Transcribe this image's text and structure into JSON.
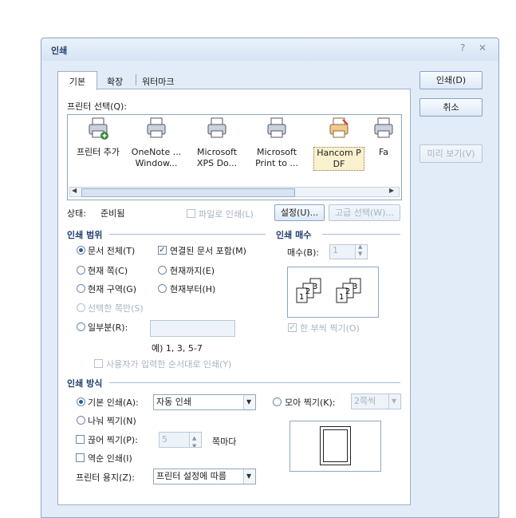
{
  "dialog": {
    "title": "인쇄",
    "help_icon": "?",
    "close_icon": "✕"
  },
  "tabs": [
    {
      "label": "기본"
    },
    {
      "label": "확장"
    },
    {
      "label": "워터마크"
    }
  ],
  "buttons": {
    "print": "인쇄(D)",
    "cancel": "취소",
    "preview": "미리 보기(V)"
  },
  "printer_select": {
    "label": "프린터 선택(Q):",
    "items": [
      {
        "label1": "프린터 추가",
        "label2": "",
        "icon": "add-printer-icon"
      },
      {
        "label1": "OneNote ...",
        "label2": "Window...",
        "icon": "printer-icon"
      },
      {
        "label1": "Microsoft",
        "label2": "XPS Do...",
        "icon": "printer-icon"
      },
      {
        "label1": "Microsoft",
        "label2": "Print to ...",
        "icon": "printer-icon"
      },
      {
        "label1": "Hancom P",
        "label2": "DF",
        "icon": "pdf-printer-icon",
        "selected": true
      },
      {
        "label1": "Fa",
        "label2": "",
        "icon": "printer-icon"
      }
    ]
  },
  "status": {
    "label": "상태:",
    "value": "준비됨",
    "print_to_file": "파일로 인쇄(L)",
    "settings_button": "설정(U)...",
    "advanced_button": "고급 선택(W)..."
  },
  "range": {
    "title": "인쇄 범위",
    "whole_doc": "문서 전체(T)",
    "include_linked": "연결된 문서 포함(M)",
    "current_page": "현재 쪽(C)",
    "to_current": "현재까지(E)",
    "current_section": "현재 구역(G)",
    "from_current": "현재부터(H)",
    "selected_pages": "선택한 쪽만(S)",
    "partial": "일부분(R):",
    "partial_value": "",
    "example": "예) 1, 3, 5-7",
    "user_order": "사용자가 입력한 순서대로 인쇄(Y)"
  },
  "copies": {
    "title": "인쇄 매수",
    "label": "매수(B):",
    "value": "1",
    "collate": "한 부씩 찍기(O)",
    "collate_digits": [
      "1",
      "2",
      "3",
      "1",
      "2",
      "3"
    ]
  },
  "method": {
    "title": "인쇄 방식",
    "basic": "기본 인쇄(A):",
    "basic_value": "자동 인쇄",
    "nup": "모아 찍기(K):",
    "nup_value": "2쪽씩",
    "split": "나눠 찍기(N)",
    "break": "끊어 찍기(P):",
    "break_value": "5",
    "break_unit": "쪽마다",
    "reverse": "역순 인쇄(I)",
    "paper_label": "프린터 용지(Z):",
    "paper_value": "프린터 설정에 따름"
  },
  "colors": {
    "highlight_box": "#e0231f",
    "section_title": "#1f3f6e"
  }
}
